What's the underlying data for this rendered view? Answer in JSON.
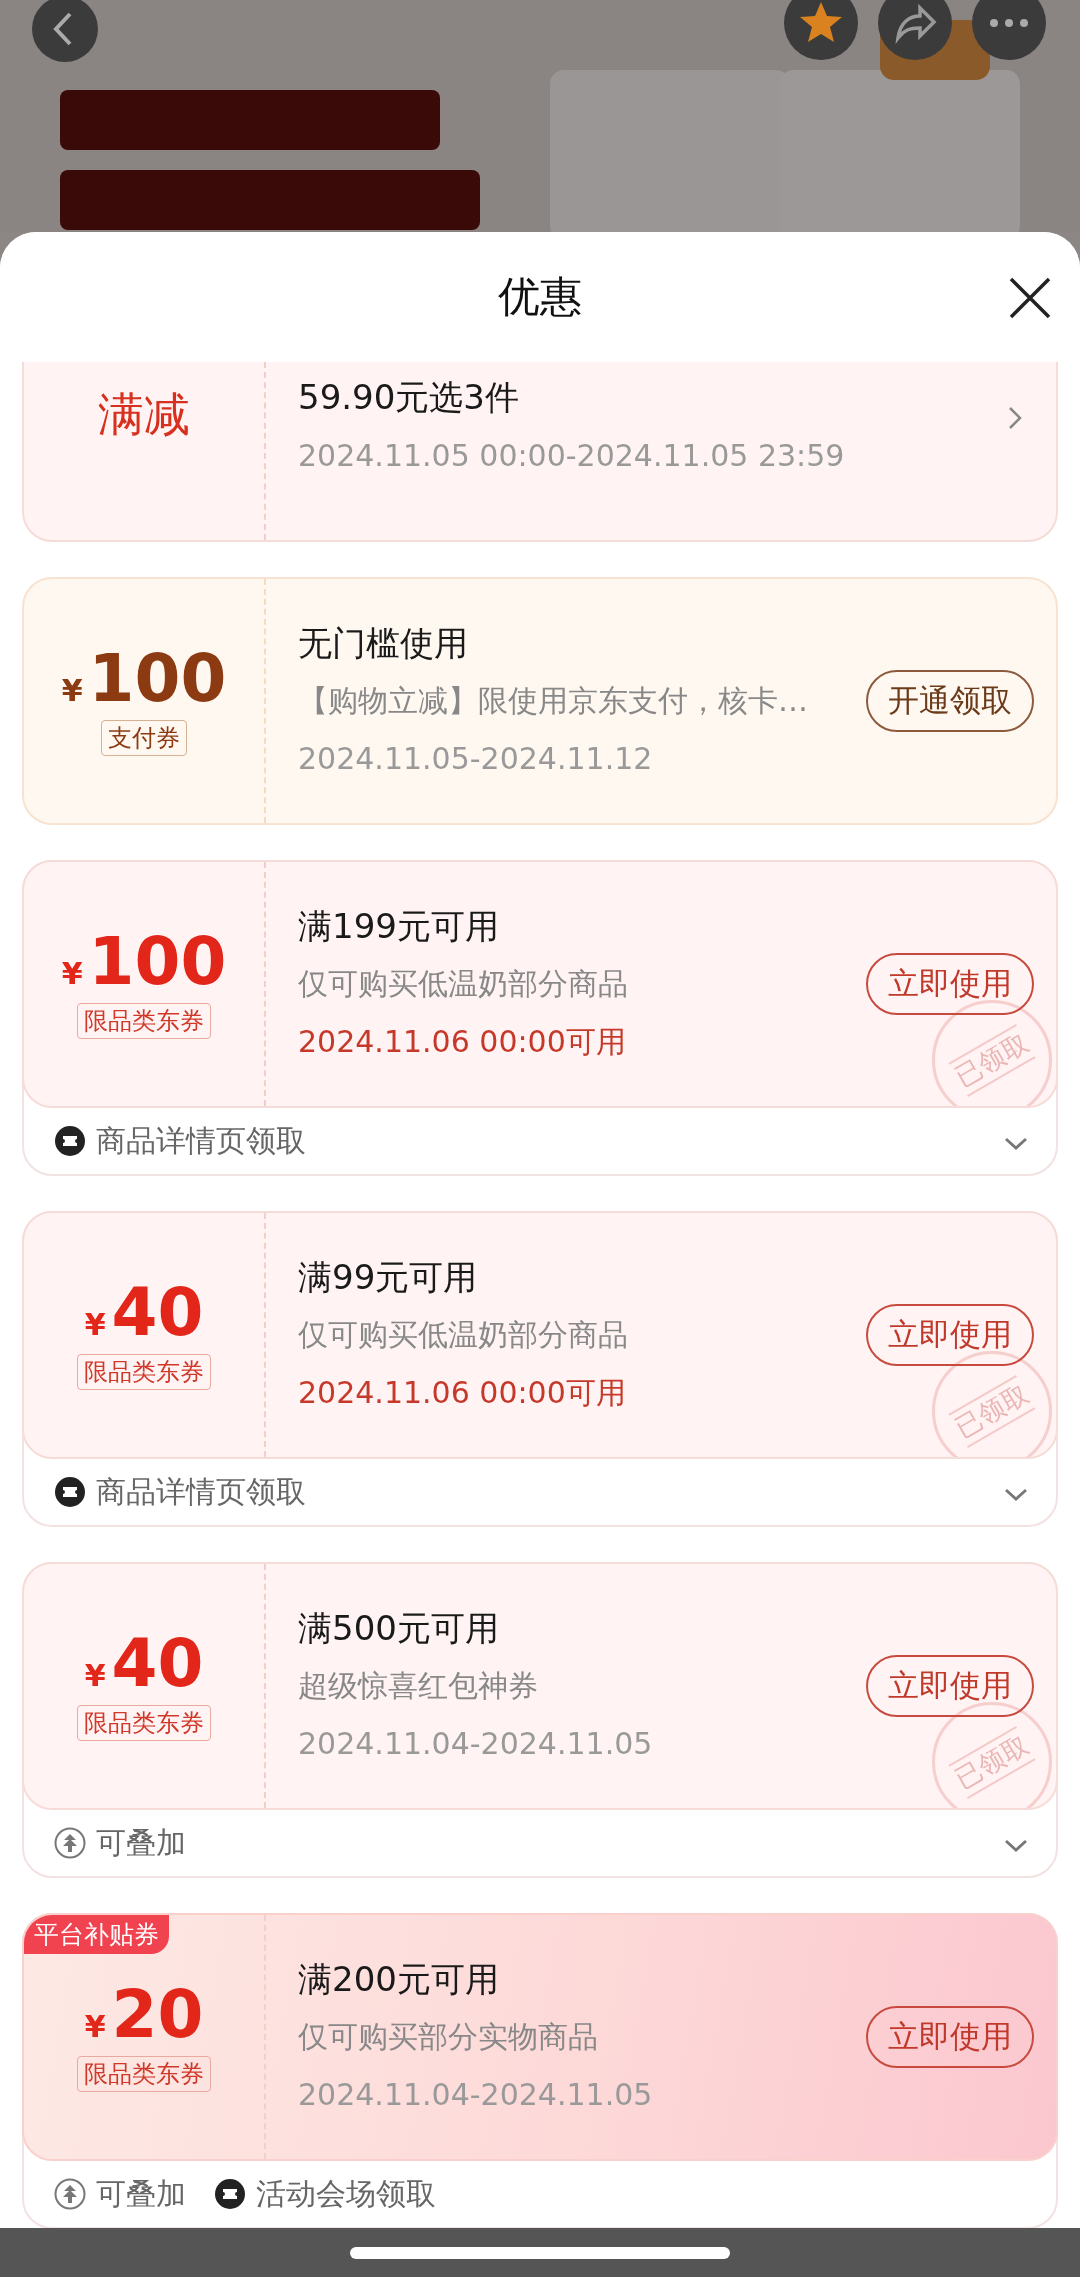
{
  "header_icons": [
    {
      "kind": "back"
    },
    {
      "kind": "star"
    },
    {
      "kind": "share"
    },
    {
      "kind": "more"
    }
  ],
  "sheet": {
    "title": "优惠"
  },
  "coupons": [
    {
      "kind": "discount",
      "label": "满减",
      "title": "59.90元选3件",
      "validity": "2024.11.05 00:00-2024.11.05 23:59"
    },
    {
      "kind": "pay",
      "currency": "¥",
      "amount": "100",
      "tag": "支付券",
      "title": "无门槛使用",
      "desc": "【购物立减】限使用京东支付，核卡…",
      "validity": "2024.11.05-2024.11.12",
      "validity_highlight": false,
      "action": "开通领取",
      "claimed": false
    },
    {
      "kind": "coupon",
      "currency": "¥",
      "amount": "100",
      "tag": "限品类东券",
      "title": "满199元可用",
      "desc": "仅可购买低温奶部分商品",
      "validity": "2024.11.06 00:00可用",
      "validity_highlight": true,
      "action": "立即使用",
      "claimed": true,
      "stamp": "已领取",
      "footer": [
        {
          "kind": "ticket",
          "text": "商品详情页领取"
        }
      ],
      "collapsible": true
    },
    {
      "kind": "coupon",
      "currency": "¥",
      "amount": "40",
      "tag": "限品类东券",
      "title": "满99元可用",
      "desc": "仅可购买低温奶部分商品",
      "validity": "2024.11.06 00:00可用",
      "validity_highlight": true,
      "action": "立即使用",
      "claimed": true,
      "stamp": "已领取",
      "footer": [
        {
          "kind": "ticket",
          "text": "商品详情页领取"
        }
      ],
      "collapsible": true
    },
    {
      "kind": "coupon",
      "currency": "¥",
      "amount": "40",
      "tag": "限品类东券",
      "title": "满500元可用",
      "desc": "超级惊喜红包神券",
      "validity": "2024.11.04-2024.11.05",
      "validity_highlight": false,
      "action": "立即使用",
      "claimed": true,
      "stamp": "已领取",
      "footer": [
        {
          "kind": "stack",
          "text": "可叠加"
        }
      ],
      "collapsible": true
    },
    {
      "kind": "coupon",
      "badge": "平台补贴券",
      "currency": "¥",
      "amount": "20",
      "tag": "限品类东券",
      "title": "满200元可用",
      "desc": "仅可购买部分实物商品",
      "validity": "2024.11.04-2024.11.05",
      "validity_highlight": false,
      "action": "立即使用",
      "claimed": false,
      "footer": [
        {
          "kind": "stack",
          "text": "可叠加"
        },
        {
          "kind": "ticket",
          "text": "活动会场领取"
        }
      ],
      "collapsible": false
    }
  ]
}
